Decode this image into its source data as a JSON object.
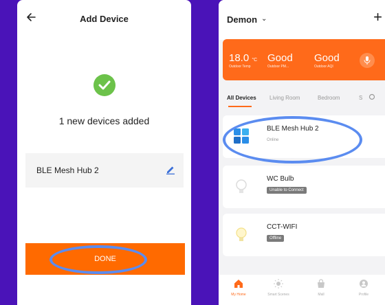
{
  "left": {
    "header": {
      "title": "Add Device"
    },
    "success_message": "1 new devices added",
    "device_name": "BLE Mesh Hub 2",
    "done_label": "DONE"
  },
  "right": {
    "home_name": "Demon",
    "weather": [
      {
        "value": "18.0",
        "unit": "°C",
        "label": "Outdoor Temp"
      },
      {
        "value": "Good",
        "unit": "",
        "label": "Outdoor PM..."
      },
      {
        "value": "Good",
        "unit": "",
        "label": "Outdoor AQI"
      }
    ],
    "tabs": [
      "All Devices",
      "Living Room",
      "Bedroom",
      "S"
    ],
    "devices": [
      {
        "name": "BLE Mesh Hub 2",
        "status": "Online"
      },
      {
        "name": "WC Bulb",
        "status": "Unable to Connect"
      },
      {
        "name": "CCT-WIFI",
        "status": "Offline"
      }
    ],
    "nav": [
      "My Home",
      "Smart Scenes",
      "Mall",
      "Profile"
    ]
  },
  "colors": {
    "background": "#4a13b8",
    "accent": "#ff6a00",
    "highlight_ring": "#5b8cf0",
    "success": "#6cc24a"
  }
}
